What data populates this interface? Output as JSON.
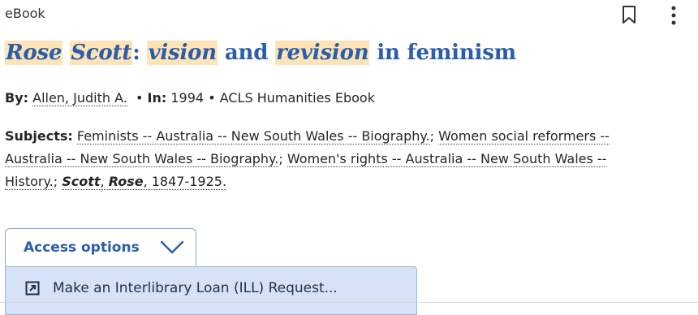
{
  "record": {
    "type": "eBook",
    "title_parts": {
      "w1": "Rose",
      "w2": "Scott",
      "colon": ":",
      "w3": "vision",
      "and": "and",
      "w4": "revision",
      "rest": "in feminism"
    },
    "by_label": "By:",
    "author": "Allen, Judith A.",
    "in_label": "In:",
    "year": "1994",
    "bullet": "•",
    "collection": "ACLS Humanities Ebook",
    "subjects_label": "Subjects:",
    "subjects": [
      "Feminists -- Australia -- New South Wales -- Biography.",
      "Women social reformers -- Australia -- New South Wales -- Biography.",
      "Women's rights -- Australia -- New South Wales -- History."
    ],
    "subject4": {
      "scott": "Scott",
      "rose": "Rose",
      "rest": ", 1847-1925."
    }
  },
  "access": {
    "label": "Access options",
    "menu_item": "Make an Interlibrary Loan (ILL) Request..."
  },
  "icons": {
    "bookmark": "bookmark-icon",
    "more": "more-vertical-icon",
    "chevron": "chevron-down-icon",
    "external": "external-link-icon"
  },
  "colors": {
    "link_blue": "#2a5dab",
    "highlight": "#fde3b6",
    "menu_bg": "#d6e3f6"
  }
}
